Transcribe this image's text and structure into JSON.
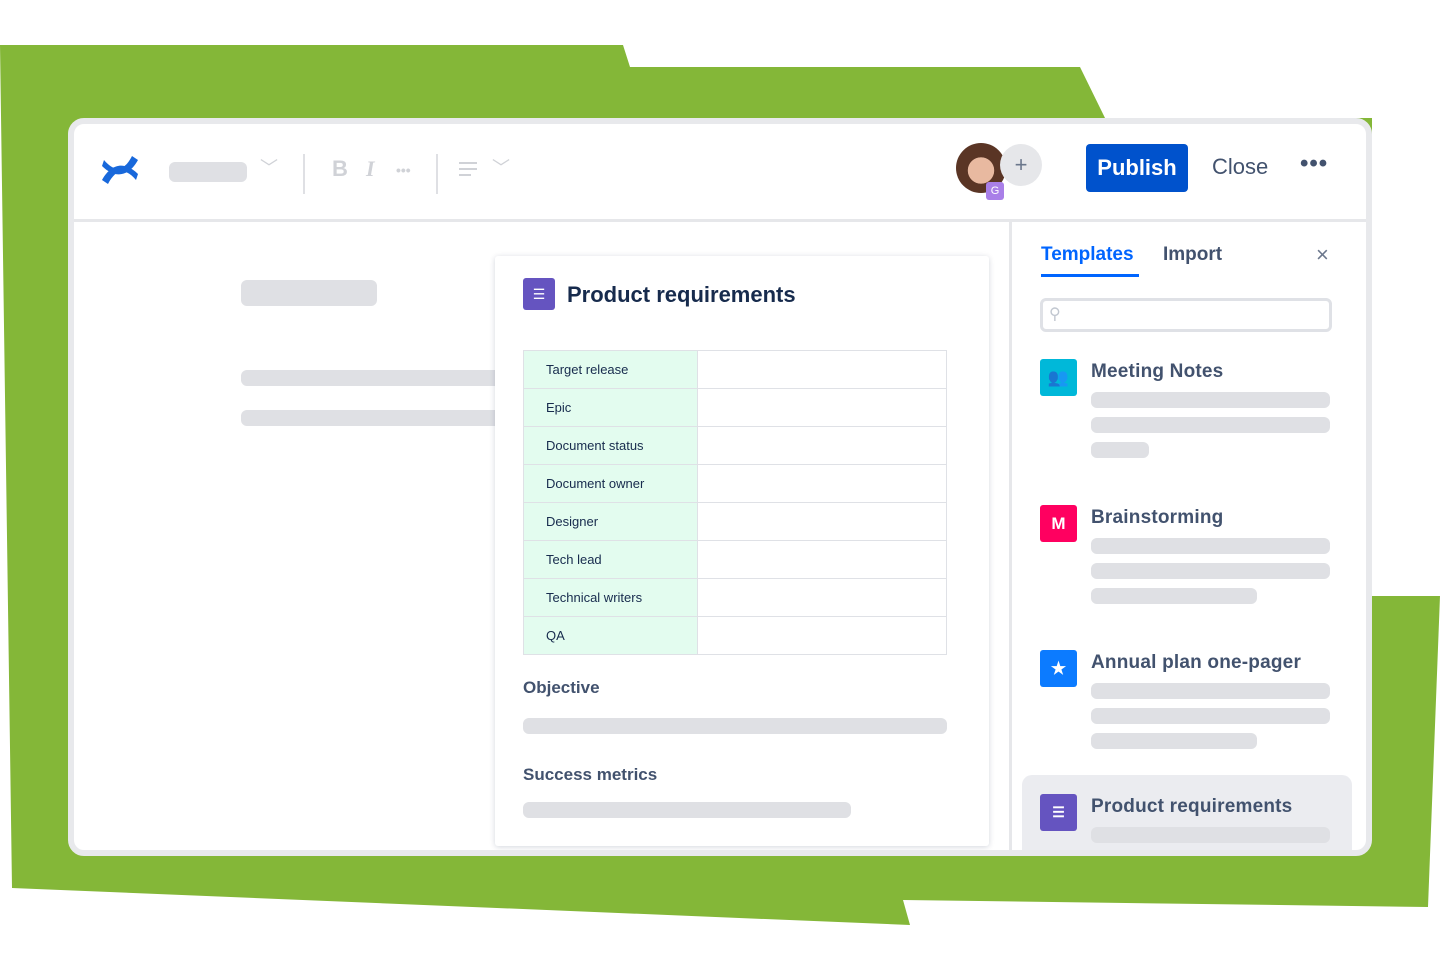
{
  "colors": {
    "background_shape": "#84b738",
    "primary": "#0052cc",
    "tab_active": "#0065ff"
  },
  "header": {
    "avatar_badge": "G",
    "add_collaborator": "+",
    "publish_label": "Publish",
    "close_label": "Close",
    "more_label": "•••",
    "bold_label": "B",
    "italic_label": "I",
    "more_format_label": "•••"
  },
  "document": {
    "title": "Product requirements",
    "table": [
      {
        "label": "Target release",
        "value": ""
      },
      {
        "label": "Epic",
        "value": ""
      },
      {
        "label": "Document status",
        "value": ""
      },
      {
        "label": "Document owner",
        "value": ""
      },
      {
        "label": "Designer",
        "value": ""
      },
      {
        "label": "Tech lead",
        "value": ""
      },
      {
        "label": "Technical writers",
        "value": ""
      },
      {
        "label": "QA",
        "value": ""
      }
    ],
    "sections": [
      "Objective",
      "Success metrics"
    ]
  },
  "panel": {
    "tabs": [
      "Templates",
      "Import"
    ],
    "active_tab": "Templates",
    "close": "×",
    "search_placeholder": "",
    "templates": [
      {
        "name": "Meeting Notes",
        "icon": "people-icon",
        "color": "#00b8d9"
      },
      {
        "name": "Brainstorming",
        "icon": "miro-m-icon",
        "color": "#ff0060",
        "glyph": "M"
      },
      {
        "name": "Annual plan one-pager",
        "icon": "star-doc-icon",
        "color": "#0c7bff"
      },
      {
        "name": "Product requirements",
        "icon": "list-icon",
        "color": "#6554c0",
        "selected": true
      }
    ]
  }
}
